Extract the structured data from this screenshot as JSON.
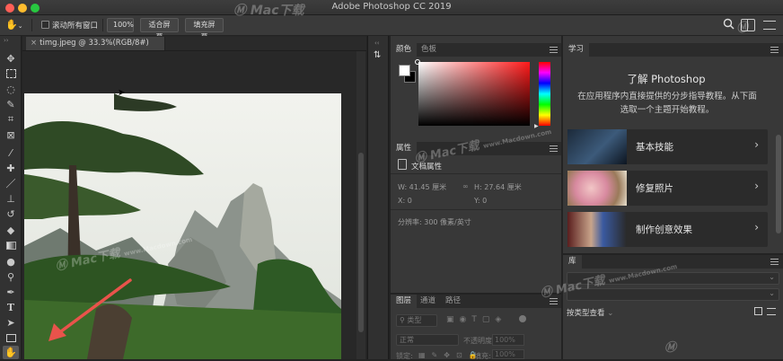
{
  "window": {
    "title": "Adobe Photoshop CC 2019"
  },
  "colors": {
    "accent": "#1473e6",
    "arrow": "#e9534b",
    "panel": "#383838",
    "panel_dark": "#2b2b2b"
  },
  "options_bar": {
    "scroll_all_label": "滚动所有窗口",
    "zoom_100": "100%",
    "fit_screen": "适合屏幕",
    "fill_screen": "填充屏幕"
  },
  "document": {
    "tab_label": "timg.jpeg @ 33.3%(RGB/8#)"
  },
  "toolbar": {
    "tools": [
      "move-tool-icon",
      "marquee-tool-icon",
      "lasso-tool-icon",
      "quick-select-icon",
      "crop-tool-icon",
      "frame-tool-icon",
      "eyedropper-icon",
      "healing-brush-icon",
      "brush-tool-icon",
      "clone-stamp-icon",
      "history-brush-icon",
      "eraser-icon",
      "gradient-icon",
      "blur-icon",
      "dodge-icon",
      "pen-tool-icon",
      "type-tool-icon",
      "path-select-icon",
      "rectangle-tool-icon",
      "hand-tool-icon"
    ]
  },
  "color_panel": {
    "tab_color": "颜色",
    "tab_swatches": "色板"
  },
  "properties_panel": {
    "tab": "属性",
    "doc_props": "文档属性",
    "w": "W: 41.45 厘米",
    "h": "H: 27.64 厘米",
    "x": "X: 0",
    "y": "Y: 0",
    "resolution": "分辨率: 300 像素/英寸"
  },
  "layers_panel": {
    "tab_layers": "图层",
    "tab_channels": "通道",
    "tab_paths": "路径",
    "filter_kind": "类型",
    "blend_mode": "正常",
    "opacity_label": "不透明度:",
    "opacity_value": "100%",
    "lock_label": "锁定:",
    "fill_label": "填充:",
    "fill_value": "100%"
  },
  "learn_panel": {
    "tab": "学习",
    "title": "了解 Photoshop",
    "description": "在应用程序内直接提供的分步指导教程。从下面选取一个主题开始教程。",
    "cards": [
      {
        "label": "基本技能"
      },
      {
        "label": "修复照片"
      },
      {
        "label": "制作创意效果"
      }
    ]
  },
  "library_panel": {
    "tab": "库",
    "view_label": "按类型查看"
  },
  "watermarks": {
    "brand": "Mac下载",
    "site": "www.Macdown.com"
  }
}
